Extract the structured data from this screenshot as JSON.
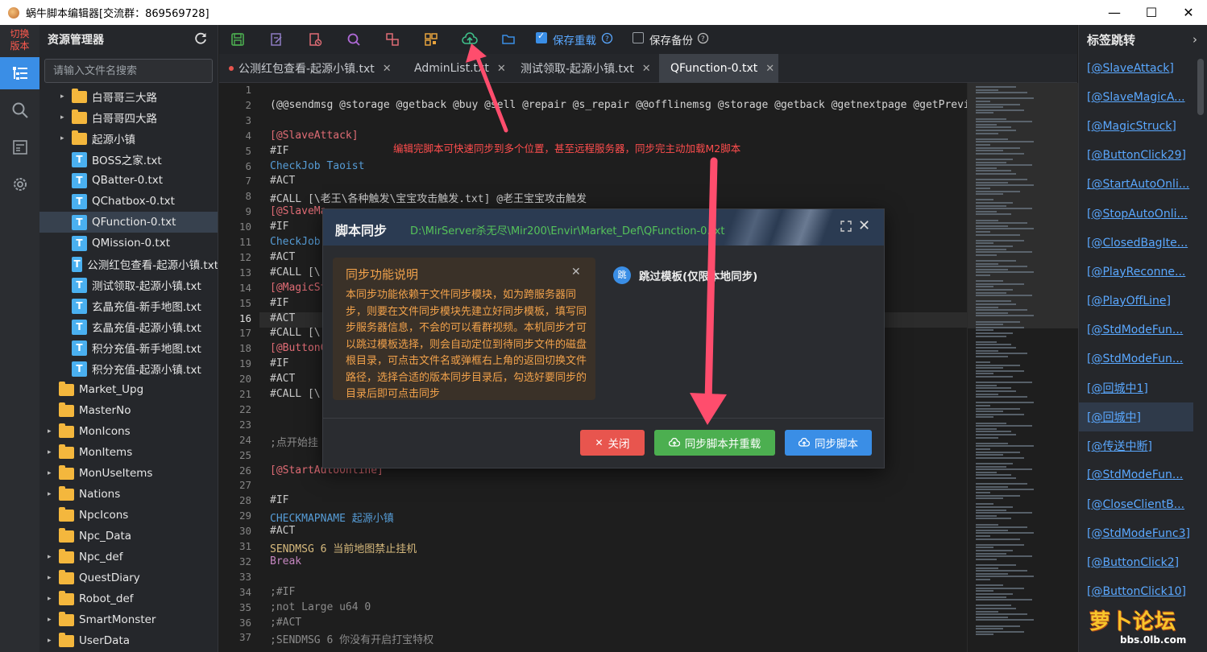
{
  "window": {
    "title": "蜗牛脚本编辑器[交流群：869569728]",
    "minimize": "—",
    "maximize": "☐",
    "close": "✕"
  },
  "activity": {
    "switch_label_1": "切换",
    "switch_label_2": "版本"
  },
  "explorer": {
    "title": "资源管理器",
    "search_placeholder": "请输入文件名搜索",
    "items": [
      {
        "label": "白哥哥三大路",
        "type": "folder",
        "level": 2,
        "arrow": "▸"
      },
      {
        "label": "白哥哥四大路",
        "type": "folder",
        "level": 2,
        "arrow": "▸"
      },
      {
        "label": "起源小镇",
        "type": "folder",
        "level": 2,
        "arrow": "▸"
      },
      {
        "label": "BOSS之家.txt",
        "type": "file",
        "level": 2,
        "arrow": ""
      },
      {
        "label": "QBatter-0.txt",
        "type": "file",
        "level": 2,
        "arrow": ""
      },
      {
        "label": "QChatbox-0.txt",
        "type": "file",
        "level": 2,
        "arrow": ""
      },
      {
        "label": "QFunction-0.txt",
        "type": "file",
        "level": 2,
        "arrow": "",
        "selected": true
      },
      {
        "label": "QMission-0.txt",
        "type": "file",
        "level": 2,
        "arrow": ""
      },
      {
        "label": "公测红包查看-起源小镇.txt",
        "type": "file",
        "level": 2,
        "arrow": ""
      },
      {
        "label": "测试领取-起源小镇.txt",
        "type": "file",
        "level": 2,
        "arrow": ""
      },
      {
        "label": "玄晶充值-新手地图.txt",
        "type": "file",
        "level": 2,
        "arrow": ""
      },
      {
        "label": "玄晶充值-起源小镇.txt",
        "type": "file",
        "level": 2,
        "arrow": ""
      },
      {
        "label": "积分充值-新手地图.txt",
        "type": "file",
        "level": 2,
        "arrow": ""
      },
      {
        "label": "积分充值-起源小镇.txt",
        "type": "file",
        "level": 2,
        "arrow": ""
      },
      {
        "label": "Market_Upg",
        "type": "folder",
        "level": 1,
        "arrow": ""
      },
      {
        "label": "MasterNo",
        "type": "folder",
        "level": 1,
        "arrow": ""
      },
      {
        "label": "MonIcons",
        "type": "folder",
        "level": 1,
        "arrow": "▸"
      },
      {
        "label": "MonItems",
        "type": "folder",
        "level": 1,
        "arrow": "▸"
      },
      {
        "label": "MonUseItems",
        "type": "folder",
        "level": 1,
        "arrow": "▸"
      },
      {
        "label": "Nations",
        "type": "folder",
        "level": 1,
        "arrow": "▸"
      },
      {
        "label": "NpcIcons",
        "type": "folder",
        "level": 1,
        "arrow": ""
      },
      {
        "label": "Npc_Data",
        "type": "folder",
        "level": 1,
        "arrow": ""
      },
      {
        "label": "Npc_def",
        "type": "folder",
        "level": 1,
        "arrow": "▸"
      },
      {
        "label": "QuestDiary",
        "type": "folder",
        "level": 1,
        "arrow": "▸"
      },
      {
        "label": "Robot_def",
        "type": "folder",
        "level": 1,
        "arrow": "▸"
      },
      {
        "label": "SmartMonster",
        "type": "folder",
        "level": 1,
        "arrow": "▸"
      },
      {
        "label": "UserData",
        "type": "folder",
        "level": 1,
        "arrow": "▸"
      }
    ]
  },
  "toolbar": {
    "save_reload_label": "保存重载",
    "save_reload_checked": true,
    "save_backup_label": "保存备份",
    "save_backup_checked": false,
    "icons": [
      "save-icon",
      "edit-file-icon",
      "delete-file-icon",
      "search-icon",
      "replace-icon",
      "qrcode-icon",
      "cloud-upload-icon",
      "folder-open-icon"
    ]
  },
  "tabs": [
    {
      "label": "公测红包查看-起源小镇.txt",
      "modified": true,
      "active": false
    },
    {
      "label": "AdminList.txt",
      "modified": false,
      "active": false
    },
    {
      "label": "测试领取-起源小镇.txt",
      "modified": false,
      "active": false
    },
    {
      "label": "QFunction-0.txt",
      "modified": false,
      "active": true
    }
  ],
  "editor": {
    "current_line": "16",
    "lines": [
      {
        "n": "1",
        "t": ""
      },
      {
        "n": "2",
        "t": "(@@sendmsg @storage @getback @buy @sell @repair @s_repair @@offlinemsg @storage @getback @getnextpage @getPreviou"
      },
      {
        "n": "3",
        "t": ""
      },
      {
        "n": "4",
        "t": "[@SlaveAttack]"
      },
      {
        "n": "5",
        "t": "#IF"
      },
      {
        "n": "6",
        "t": "CheckJob Taoist"
      },
      {
        "n": "7",
        "t": "#ACT"
      },
      {
        "n": "8",
        "t": "#CALL [\\老王\\各种触发\\宝宝攻击触发.txt] @老王宝宝攻击触发"
      },
      {
        "n": "9",
        "t": "[@SlaveMa"
      },
      {
        "n": "10",
        "t": "#IF"
      },
      {
        "n": "11",
        "t": "CheckJob"
      },
      {
        "n": "12",
        "t": "#ACT"
      },
      {
        "n": "13",
        "t": "#CALL [\\"
      },
      {
        "n": "14",
        "t": "[@MagicSt"
      },
      {
        "n": "15",
        "t": "#IF"
      },
      {
        "n": "16",
        "t": "#ACT"
      },
      {
        "n": "17",
        "t": "#CALL [\\"
      },
      {
        "n": "18",
        "t": "[@ButtonC"
      },
      {
        "n": "19",
        "t": "#IF"
      },
      {
        "n": "20",
        "t": "#ACT"
      },
      {
        "n": "21",
        "t": "#CALL [\\"
      },
      {
        "n": "22",
        "t": ""
      },
      {
        "n": "23",
        "t": ""
      },
      {
        "n": "24",
        "t": ";点开始挂"
      },
      {
        "n": "25",
        "t": ""
      },
      {
        "n": "26",
        "t": "[@StartAutoOnline]"
      },
      {
        "n": "27",
        "t": ""
      },
      {
        "n": "28",
        "t": "#IF"
      },
      {
        "n": "29",
        "t": "CHECKMAPNAME 起源小镇"
      },
      {
        "n": "30",
        "t": "#ACT"
      },
      {
        "n": "31",
        "t": "SENDMSG 6 当前地图禁止挂机"
      },
      {
        "n": "32",
        "t": "Break"
      },
      {
        "n": "33",
        "t": ""
      },
      {
        "n": "34",
        "t": ";#IF"
      },
      {
        "n": "35",
        "t": ";not Large u64 0"
      },
      {
        "n": "36",
        "t": ";#ACT"
      },
      {
        "n": "37",
        "t": ";SENDMSG 6 你没有开启打宝特权"
      }
    ]
  },
  "annotation": "编辑完脚本可快速同步到多个位置，甚至远程服务器，同步完主动加载M2脚本",
  "bookmarks": {
    "title": "标签跳转",
    "items": [
      {
        "label": "[@SlaveAttack]"
      },
      {
        "label": "[@SlaveMagicA..."
      },
      {
        "label": "[@MagicStruck]"
      },
      {
        "label": "[@ButtonClick29]"
      },
      {
        "label": "[@StartAutoOnli..."
      },
      {
        "label": "[@StopAutoOnli..."
      },
      {
        "label": "[@ClosedBagIte..."
      },
      {
        "label": "[@PlayReconne..."
      },
      {
        "label": "[@PlayOffLine]"
      },
      {
        "label": "[@StdModeFun..."
      },
      {
        "label": "[@StdModeFun..."
      },
      {
        "label": "[@回城中1]"
      },
      {
        "label": "[@回城中]",
        "active": true
      },
      {
        "label": "[@传送中断]"
      },
      {
        "label": "[@StdModeFun..."
      },
      {
        "label": "[@CloseClientB..."
      },
      {
        "label": "[@StdModeFunc3]"
      },
      {
        "label": "[@ButtonClick2]"
      },
      {
        "label": "[@ButtonClick10]"
      }
    ]
  },
  "modal": {
    "title": "脚本同步",
    "path": "D:\\MirServer杀无尽\\Mir200\\Envir\\Market_Def\\QFunction-0.txt",
    "note_title": "同步功能说明",
    "note_body": "本同步功能依赖于文件同步模块，如为跨服务器同步，则要在文件同步模块先建立好同步模板，填写同步服务器信息，不会的可以看群视频。本机同步才可以跳过模板选择，则会自动定位到待同步文件的磁盘根目录，可点击文件名或弹框右上角的返回切换文件路径，选择合适的版本同步目录后，勾选好要同步的目录后即可点击同步",
    "skip_badge": "跳",
    "skip_label": "跳过模板(仅限本地同步)",
    "btn_close": "关闭",
    "btn_sync_reload": "同步脚本并重载",
    "btn_sync": "同步脚本"
  },
  "watermark": {
    "logo_text": "萝卜论坛",
    "url": "bbs.0lb.com"
  },
  "colors": {
    "accent": "#3a8ee6",
    "danger": "#e8554e",
    "success": "#4caf50",
    "link": "#5aa8ff",
    "annotation": "#ff4d4d",
    "note_text": "#f2a24b",
    "path_text": "#55c35a"
  }
}
